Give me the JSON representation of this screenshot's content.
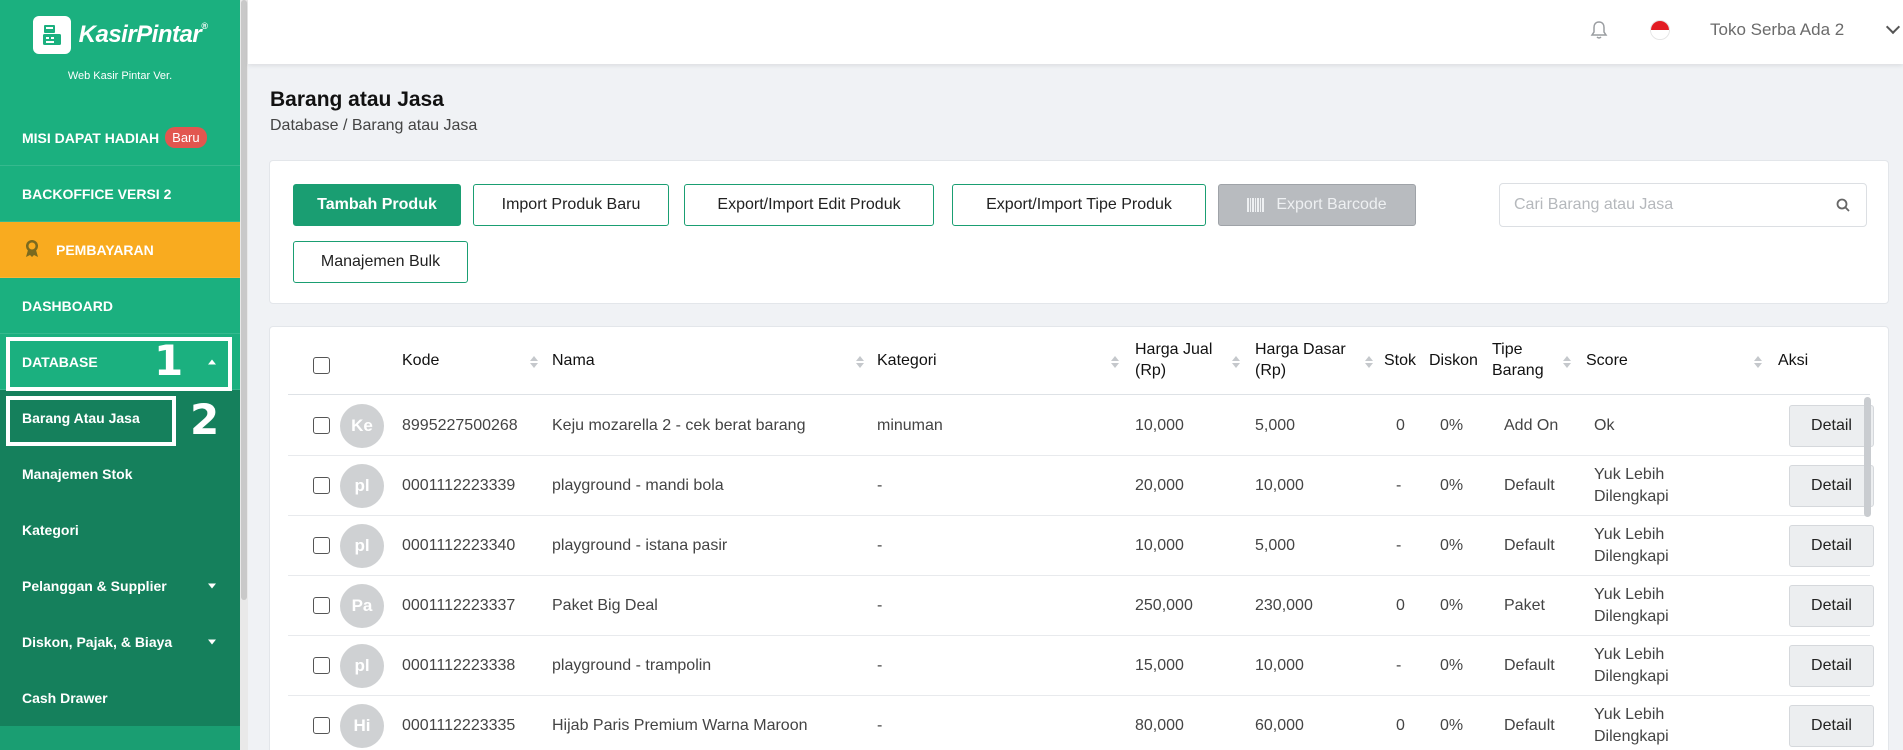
{
  "sidebar": {
    "brand": "KasirPintar",
    "brand_reg": "®",
    "version": "Web Kasir Pintar Ver.",
    "mission": {
      "label": "MISI DAPAT HADIAH",
      "badge": "Baru"
    },
    "backoffice": "BACKOFFICE VERSI 2",
    "payment": "PEMBAYARAN",
    "dashboard": "DASHBOARD",
    "database": "DATABASE",
    "sub_items": [
      "Barang Atau Jasa",
      "Manajemen Stok",
      "Kategori",
      "Pelanggan & Supplier",
      "Diskon, Pajak, & Biaya",
      "Cash Drawer"
    ],
    "annotations": [
      "1",
      "2"
    ]
  },
  "topbar": {
    "store_name": "Toko Serba Ada 2",
    "icons": [
      "bell-icon",
      "indonesia-flag-icon",
      "chevron-down-icon"
    ]
  },
  "page": {
    "title": "Barang atau Jasa",
    "breadcrumb": "Database / Barang atau Jasa"
  },
  "actions": {
    "add_product": "Tambah Produk",
    "import_new": "Import Produk Baru",
    "export_import_edit": "Export/Import Edit Produk",
    "export_import_type": "Export/Import Tipe Produk",
    "export_barcode": "Export Barcode",
    "bulk": "Manajemen Bulk"
  },
  "search": {
    "placeholder": "Cari Barang atau Jasa",
    "value": ""
  },
  "table": {
    "headers": {
      "kode": "Kode",
      "nama": "Nama",
      "kategori": "Kategori",
      "harga_jual": "Harga Jual (Rp)",
      "harga_dasar": "Harga Dasar (Rp)",
      "stok": "Stok",
      "diskon": "Diskon",
      "tipe": "Tipe Barang",
      "score": "Score",
      "aksi": "Aksi"
    },
    "detail_label": "Detail",
    "rows": [
      {
        "avatar": "Ke",
        "kode": "8995227500268",
        "nama": "Keju mozarella 2 - cek berat barang",
        "kategori": "minuman",
        "harga_jual": "10,000",
        "harga_dasar": "5,000",
        "stok": "0",
        "diskon": "0%",
        "tipe": "Add On",
        "score": "Ok"
      },
      {
        "avatar": "pl",
        "kode": "0001112223339",
        "nama": "playground - mandi bola",
        "kategori": "-",
        "harga_jual": "20,000",
        "harga_dasar": "10,000",
        "stok": "-",
        "diskon": "0%",
        "tipe": "Default",
        "score": "Yuk Lebih Dilengkapi"
      },
      {
        "avatar": "pl",
        "kode": "0001112223340",
        "nama": "playground - istana pasir",
        "kategori": "-",
        "harga_jual": "10,000",
        "harga_dasar": "5,000",
        "stok": "-",
        "diskon": "0%",
        "tipe": "Default",
        "score": "Yuk Lebih Dilengkapi"
      },
      {
        "avatar": "Pa",
        "kode": "0001112223337",
        "nama": "Paket Big Deal",
        "kategori": "-",
        "harga_jual": "250,000",
        "harga_dasar": "230,000",
        "stok": "0",
        "diskon": "0%",
        "tipe": "Paket",
        "score": "Yuk Lebih Dilengkapi"
      },
      {
        "avatar": "pl",
        "kode": "0001112223338",
        "nama": "playground - trampolin",
        "kategori": "-",
        "harga_jual": "15,000",
        "harga_dasar": "10,000",
        "stok": "-",
        "diskon": "0%",
        "tipe": "Default",
        "score": "Yuk Lebih Dilengkapi"
      },
      {
        "avatar": "Hi",
        "kode": "0001112223335",
        "nama": "Hijab Paris Premium Warna Maroon",
        "kategori": "-",
        "harga_jual": "80,000",
        "harga_dasar": "60,000",
        "stok": "0",
        "diskon": "0%",
        "tipe": "Default",
        "score": "Yuk Lebih Dilengkapi"
      }
    ]
  },
  "colors": {
    "brand_green": "#1a9e72",
    "sidebar_light": "#1bb07f",
    "payment_orange": "#f9ab1f",
    "badge_red": "#e2564f"
  }
}
